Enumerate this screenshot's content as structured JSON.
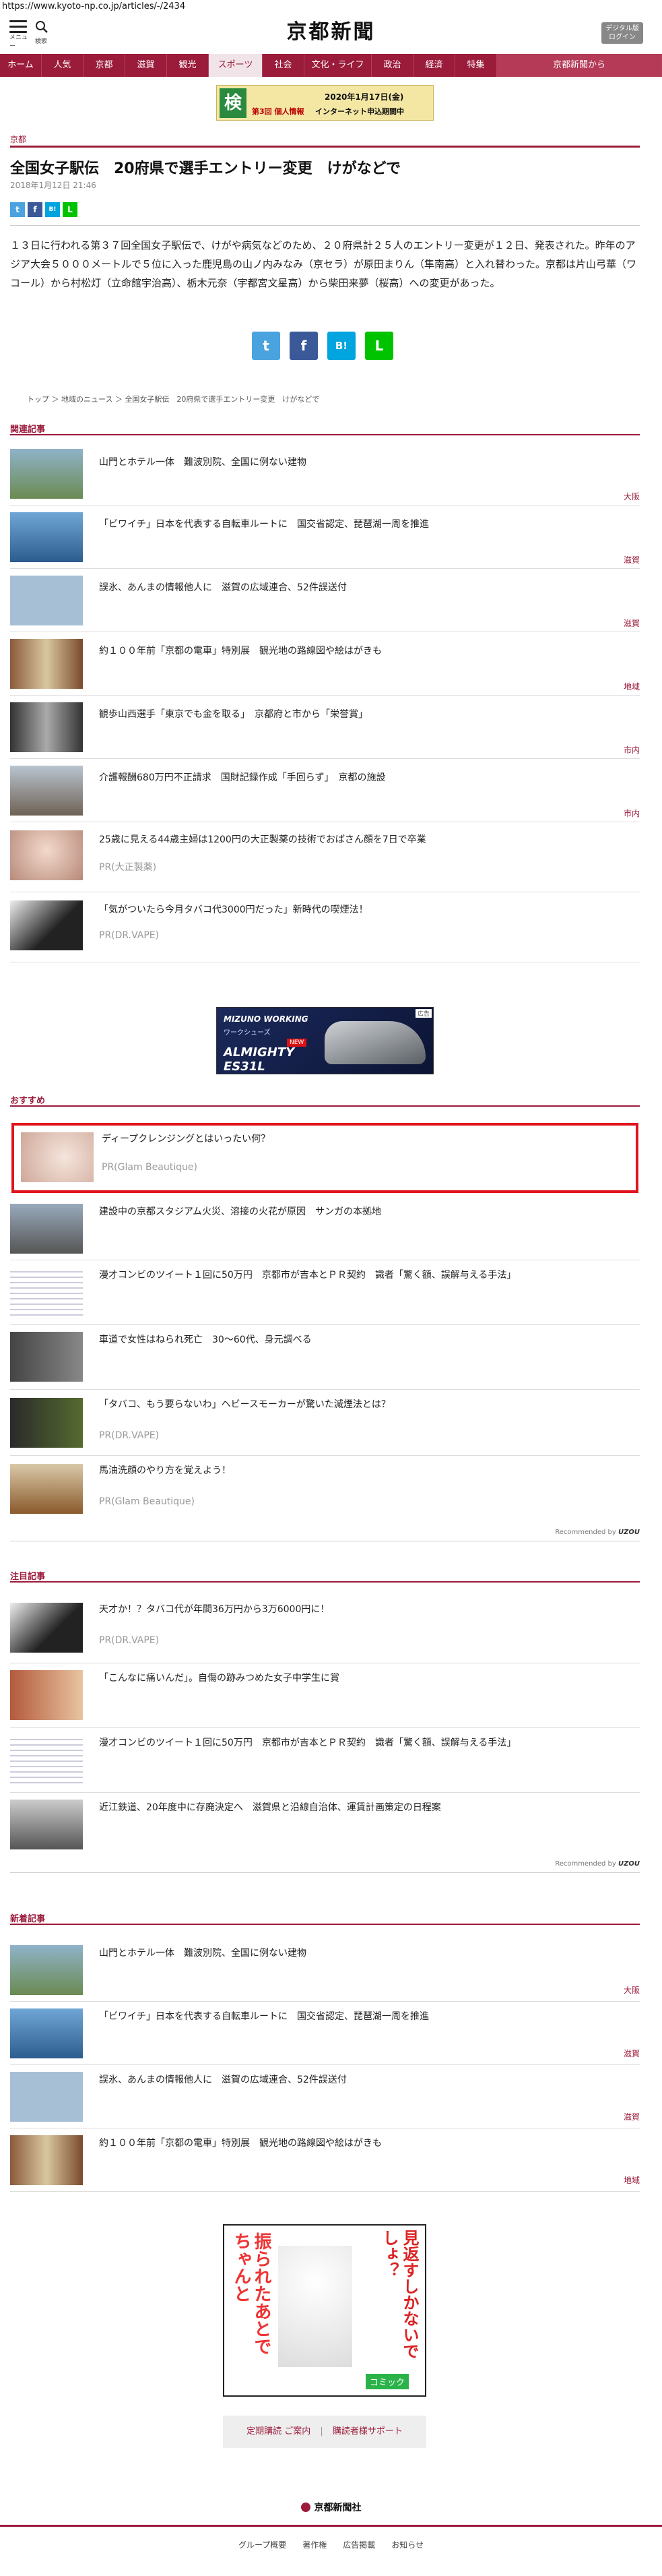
{
  "url": "https://www.kyoto-np.co.jp/articles/-/2434",
  "header": {
    "menu_label": "メニュー",
    "search_label": "検索",
    "logo": "京都新聞",
    "digital_label_1": "デジタル版",
    "digital_label_2": "ログイン"
  },
  "nav": [
    "ホーム",
    "人気",
    "京都",
    "滋賀",
    "観光",
    "スポーツ",
    "社会",
    "文化・ライフ",
    "政治",
    "経済",
    "特集",
    "京都新聞から"
  ],
  "top_ad": {
    "line1": "第3回 個人情報",
    "line2": "インターネット申込期間中",
    "line3": "2020年1月17日(金)",
    "badge": "検"
  },
  "article": {
    "category": "京都",
    "title": "全国女子駅伝　20府県で選手エントリー変更　けがなどで",
    "date": "2018年1月12日 21:46",
    "body": "１３日に行われる第３７回全国女子駅伝で、けがや病気などのため、２０府県計２５人のエントリー変更が１２日、発表された。昨年のアジア大会５０００メートルで５位に入った鹿児島の山ノ内みなみ（京セラ）が原田まりん（隼南高）と入れ替わった。京都は片山弓華（ワコール）から村松灯（立命館宇治高）、栃木元奈（宇都宮文星高）から柴田来夢（桜高）への変更があった。",
    "breadcrumb": "トップ ＞ 地域のニュース ＞ 全国女子駅伝　20府県で選手エントリー変更　けがなどで"
  },
  "share": {
    "twitter": "t",
    "facebook": "f",
    "hatena": "B!",
    "line": "L"
  },
  "related": {
    "title": "関連記事",
    "items": [
      {
        "title": "山門とホテル一体　難波別院、全国に例ない建物",
        "tag": "大阪"
      },
      {
        "title": "「ビワイチ」日本を代表する自転車ルートに　国交省認定、琵琶湖一周を推進",
        "tag": "滋賀"
      },
      {
        "title": "誤氷、あんまの情報他人に　滋賀の広域連合、52件誤送付",
        "tag": "滋賀"
      },
      {
        "title": "約１００年前「京都の電車」特別展　観光地の路線図や絵はがきも",
        "tag": "地域"
      },
      {
        "title": "観歩山西選手「東京でも金を取る」　京都府と市から「栄誉賞」",
        "tag": "市内"
      },
      {
        "title": "介護報酬680万円不正請求　国財記録作成「手回らず」　京都の施設",
        "tag": "市内"
      },
      {
        "title": "25歳に見える44歳主婦は1200円の大正製薬の技術でおばさん顔を7日で卒業",
        "pr": "PR(大正製薬)"
      },
      {
        "title": "「気がついたら今月タバコ代3000円だった」新時代の喫煙法！",
        "pr": "PR(DR.VAPE)"
      }
    ]
  },
  "mid_ad": {
    "brand": "MIZUNO WORKING",
    "sub": "ワークシューズ",
    "model": "ALMIGHTY ES31L",
    "badge": "NEW",
    "corner": "広告"
  },
  "recommended": {
    "title": "おすすめ",
    "by_label": "Recommended by",
    "by_brand": "UZOU",
    "items": [
      {
        "title": "ディープクレンジングとはいったい何？",
        "pr": "PR(Glam Beautique)"
      },
      {
        "title": "建設中の京都スタジアム火災、溶接の火花が原因　サンガの本拠地"
      },
      {
        "title": "漫才コンビのツイート１回に50万円　京都市が吉本とＰＲ契約　識者「驚く額、誤解与える手法」"
      },
      {
        "title": "車道で女性はねられ死亡　30～60代、身元調べる"
      },
      {
        "title": "「タバコ、もう要らないわ」ヘビースモーカーが驚いた減煙法とは？",
        "pr": "PR(DR.VAPE)"
      },
      {
        "title": "馬油洗顔のやり方を覚えよう！",
        "pr": "PR(Glam Beautique)"
      }
    ]
  },
  "featured": {
    "title": "注目記事",
    "by_label": "Recommended by",
    "by_brand": "UZOU",
    "items": [
      {
        "title": "天才か！？タバコ代が年間36万円から3万6000円に！",
        "pr": "PR(DR.VAPE)"
      },
      {
        "title": "「こんなに痛いんだ」。自傷の跡みつめた女子中学生に賞"
      },
      {
        "title": "漫才コンビのツイート１回に50万円　京都市が吉本とＰＲ契約　識者「驚く額、誤解与える手法」"
      },
      {
        "title": "近江鉄道、20年度中に存廃決定へ　滋賀県と沿線自治体、運賃計画策定の日程案"
      }
    ]
  },
  "latest": {
    "title": "新着記事",
    "items": [
      {
        "title": "山門とホテル一体　難波別院、全国に例ない建物",
        "tag": "大阪"
      },
      {
        "title": "「ビワイチ」日本を代表する自転車ルートに　国交省認定、琵琶湖一周を推進",
        "tag": "滋賀"
      },
      {
        "title": "誤氷、あんまの情報他人に　滋賀の広域連合、52件誤送付",
        "tag": "滋賀"
      },
      {
        "title": "約１００年前「京都の電車」特別展　観光地の路線図や絵はがきも",
        "tag": "地域"
      }
    ]
  },
  "manga_ad": {
    "text1": "見返すしかないでしょ？",
    "text2": "振られたあとでちゃんと",
    "label": "コミック"
  },
  "bottom_buttons": {
    "left": "定期購読 ご案内",
    "sep": "|",
    "right": "購読者様サポート"
  },
  "footer": {
    "company": "京都新聞社",
    "links": [
      "グループ概要",
      "著作権",
      "広告掲載",
      "お知らせ"
    ]
  },
  "colors": {
    "brand": "#9b1b3b",
    "twitter": "#4aa3df",
    "facebook": "#3b5998",
    "hatena": "#00a4de",
    "line": "#00c300"
  }
}
